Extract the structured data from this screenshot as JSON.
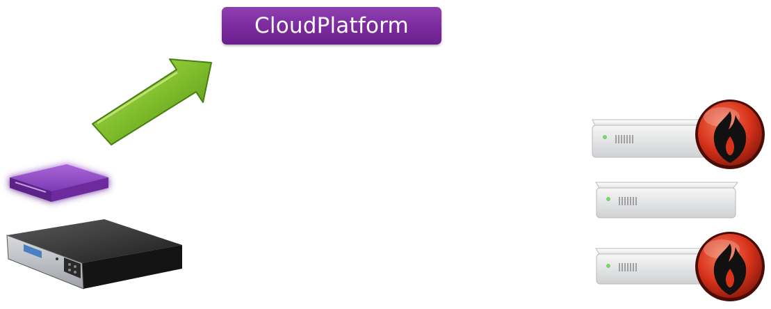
{
  "platform_label": {
    "text": "CloudPlatform",
    "color": "#7a2a9c"
  },
  "nodes": {
    "arrow": {
      "icon": "green-arrow-icon",
      "color": "#6fb024"
    },
    "virtual_appliance": {
      "icon": "virtual-appliance-icon",
      "color": "#7d3ab5"
    },
    "hardware_appliance": {
      "icon": "hardware-appliance-icon",
      "color": "#1b1b1b"
    },
    "servers": [
      {
        "icon": "server-icon",
        "status": "firewall-icon"
      },
      {
        "icon": "server-icon",
        "status": ""
      },
      {
        "icon": "server-icon",
        "status": "firewall-icon"
      }
    ],
    "firewall_color": "#d8321a"
  }
}
